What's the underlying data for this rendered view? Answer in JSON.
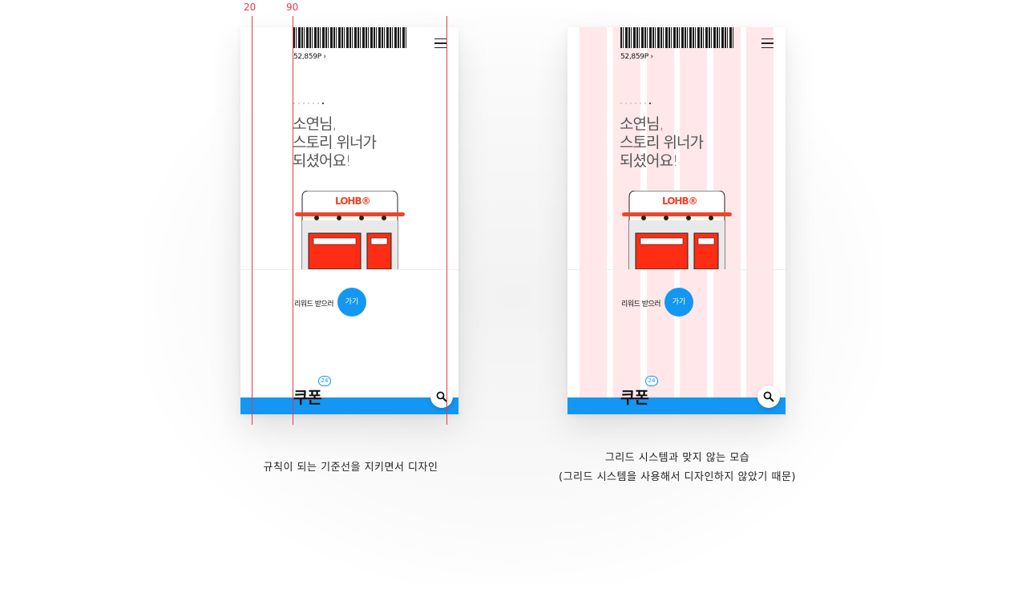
{
  "guides": {
    "label_20": "20",
    "label_90": "90"
  },
  "colors": {
    "accent_blue": "#1497f2",
    "guide_red": "#e63a4a",
    "grid_pink": "#ffd6db",
    "store_red": "#ff2d14"
  },
  "phone": {
    "points": "52,859P ›",
    "headline": "소연님,\n스토리 위너가\n되셨어요!",
    "logo": "LOHB®",
    "reward_text": "리워드 받으러",
    "go_button": "가기",
    "coupon_title": "쿠폰",
    "coupon_badge": "24",
    "icons": {
      "menu": "hamburger-menu-icon",
      "search": "search-icon"
    }
  },
  "captions": {
    "left": "규칙이 되는 기준선을 지키면서 디자인",
    "right_line1": "그리드 시스템과 맞지 않는 모습",
    "right_line2": "(그리드 시스템을 사용해서 디자인하지 않았기 때문)"
  }
}
